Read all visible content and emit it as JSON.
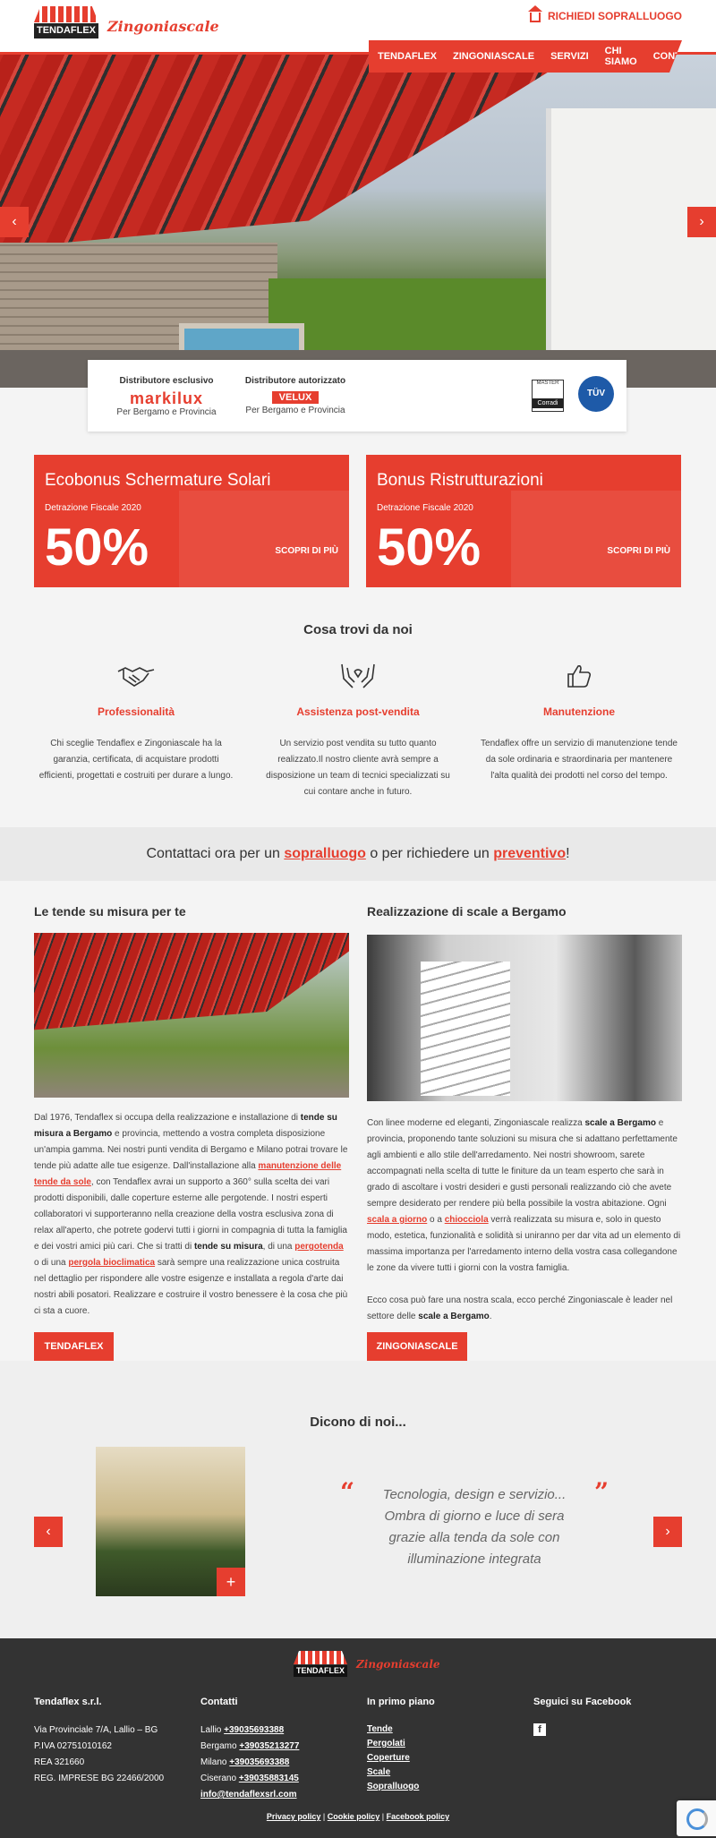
{
  "header": {
    "brand_word": "TENDAFLEX",
    "brand_script": "Zingoniascale",
    "cta_label": "RICHIEDI SOPRALLUOGO",
    "nav": [
      "TENDAFLEX",
      "ZINGONIASCALE",
      "SERVIZI",
      "CHI SIAMO",
      "CONTATTI"
    ]
  },
  "hero": {
    "prev": "‹",
    "next": "›"
  },
  "distributors": {
    "exclusive_label": "Distributore esclusivo",
    "exclusive_brand": "markilux",
    "exclusive_area": "Per Bergamo e Provincia",
    "authorized_label": "Distributore autorizzato",
    "authorized_brand": "VELUX",
    "authorized_area": "Per Bergamo e Provincia",
    "badge1_top": "MASTER",
    "badge1_bottom": "Corradi",
    "badge2": "TÜV"
  },
  "promos": [
    {
      "title": "Ecobonus Schermature Solari",
      "subtitle": "Detrazione Fiscale 2020",
      "percent": "50%",
      "cta": "SCOPRI DI PIÙ"
    },
    {
      "title": "Bonus Ristrutturazioni",
      "subtitle": "Detrazione Fiscale 2020",
      "percent": "50%",
      "cta": "SCOPRI DI PIÙ"
    }
  ],
  "features": {
    "title": "Cosa trovi da noi",
    "items": [
      {
        "title": "Professionalità",
        "text": "Chi sceglie Tendaflex e Zingoniascale ha la garanzia, certificata, di acquistare prodotti efficienti, progettati e costruiti per durare a lungo.",
        "icon": "handshake-icon"
      },
      {
        "title": "Assistenza post-vendita",
        "text": "Un servizio post vendita su tutto quanto realizzato.Il nostro cliente avrà sempre a disposizione un team di tecnici specializzati su cui contare anche in futuro.",
        "icon": "caring-hands-icon"
      },
      {
        "title": "Manutenzione",
        "text": "Tendaflex offre un servizio di manutenzione tende da sole ordinaria e straordinaria per mantenere l'alta qualità dei prodotti nel corso del tempo.",
        "icon": "thumbs-up-icon"
      }
    ]
  },
  "contact_strip": {
    "pre": "Contattaci ora per un ",
    "link1": "sopralluogo",
    "mid": " o per richiedere un ",
    "link2": "preventivo",
    "post": "!"
  },
  "left_col": {
    "title": "Le tende su misura per te",
    "p1": "Dal 1976, Tendaflex si occupa della realizzazione e installazione di ",
    "b1": "tende su misura a Bergamo",
    "p2": " e provincia, mettendo a vostra completa disposizione un'ampia gamma. Nei nostri punti vendita di Bergamo e Milano potrai trovare le tende più adatte alle tue esigenze. Dall'installazione alla ",
    "l1": "manutenzione delle tende da sole",
    "p3": ", con Tendaflex avrai un supporto a 360° sulla scelta dei vari prodotti disponibili, dalle coperture esterne alle pergotende. I nostri esperti collaboratori vi supporteranno nella creazione della vostra esclusiva zona di relax all'aperto, che potrete godervi tutti i giorni in compagnia di tutta la famiglia e dei vostri amici più cari. Che si tratti di ",
    "b2": "tende su misura",
    "p4": ", di una ",
    "l2": "pergotenda",
    "p5": " o di una ",
    "l3": "pergola bioclimatica",
    "p6": " sarà sempre una realizzazione unica costruita nel dettaglio per rispondere alle vostre esigenze e installata a regola d'arte dai nostri abili posatori. Realizzare e costruire il vostro benessere è la cosa che più ci sta a cuore.",
    "button": "TENDAFLEX"
  },
  "right_col": {
    "title": "Realizzazione di scale a Bergamo",
    "p1": "Con linee moderne ed eleganti, Zingoniascale realizza ",
    "b1": "scale a Bergamo",
    "p2": " e provincia, proponendo tante soluzioni su misura che si adattano perfettamente agli ambienti e allo stile dell'arredamento. Nei nostri showroom, sarete accompagnati nella scelta di tutte le finiture da un team esperto che sarà in grado di ascoltare i vostri desideri e gusti personali realizzando ciò che avete sempre desiderato per rendere più bella possibile la vostra abitazione. Ogni ",
    "l1": "scala a giorno",
    "p3": " o a ",
    "l2": "chiocciola",
    "p4": " verrà realizzata su misura e, solo in questo modo, estetica, funzionalità e solidità si uniranno per dar vita ad un elemento di massima importanza per l'arredamento interno della vostra casa collegandone le zone da vivere tutti i giorni con la vostra famiglia.",
    "p5": "Ecco cosa può fare una nostra scala, ecco perché Zingoniascale è leader nel settore delle ",
    "b2": "scale a Bergamo",
    "p6": ".",
    "button": "ZINGONIASCALE"
  },
  "testimonials": {
    "title": "Dicono di noi...",
    "quote": "Tecnologia, design e servizio... Ombra di giorno e luce di sera grazie alla tenda da sole con illuminazione integrata",
    "open_mark": "“",
    "close_mark": "”",
    "plus": "+",
    "prev": "‹",
    "next": "›"
  },
  "footer": {
    "brand_word": "TENDAFLEX",
    "brand_script": "Zingoniascale",
    "company": {
      "title": "Tendaflex s.r.l.",
      "lines": [
        "Via Provinciale 7/A, Lallio – BG",
        "P.IVA 02751010162",
        "REA 321660",
        "REG. IMPRESE BG 22466/2000"
      ]
    },
    "contacts": {
      "title": "Contatti",
      "rows": [
        {
          "label": "Lallio ",
          "value": "+39035693388"
        },
        {
          "label": "Bergamo ",
          "value": "+39035213277"
        },
        {
          "label": "Milano ",
          "value": "+39035693388"
        },
        {
          "label": "Ciserano ",
          "value": "+39035883145"
        }
      ],
      "email": "info@tendaflexsrl.com"
    },
    "highlights": {
      "title": "In primo piano",
      "links": [
        "Tende",
        "Pergolati",
        "Coperture",
        "Scale",
        "Sopralluogo"
      ]
    },
    "facebook": {
      "title": "Seguici su Facebook",
      "icon": "f"
    },
    "legal": [
      "Privacy policy",
      "Cookie policy",
      "Facebook policy"
    ],
    "separator": " | "
  }
}
